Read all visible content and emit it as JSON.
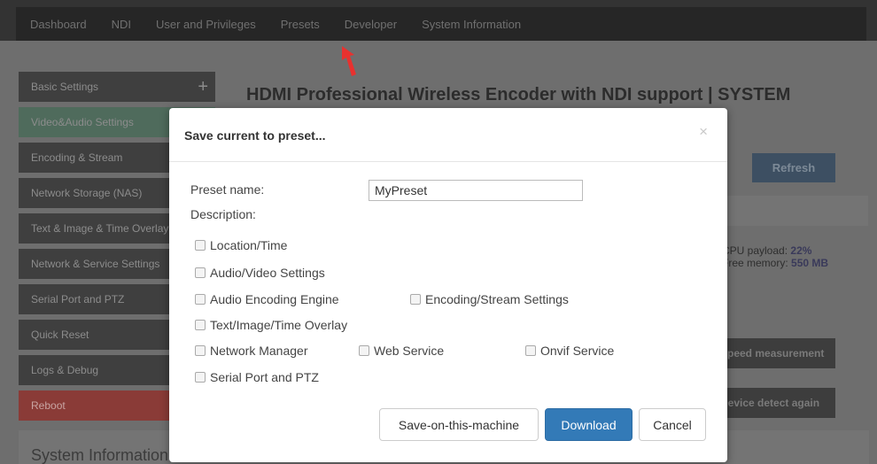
{
  "topnav": {
    "items": [
      "Dashboard",
      "NDI",
      "User and Privileges",
      "Presets",
      "Developer",
      "System Information"
    ]
  },
  "sidebar": {
    "items": [
      {
        "label": "Basic Settings",
        "expand": "+"
      },
      {
        "label": "Video&Audio Settings"
      },
      {
        "label": "Encoding & Stream"
      },
      {
        "label": "Network Storage (NAS)"
      },
      {
        "label": "Text & Image & Time Overlay"
      },
      {
        "label": "Network & Service Settings"
      },
      {
        "label": "Serial Port and PTZ"
      },
      {
        "label": "Quick Reset"
      },
      {
        "label": "Logs & Debug"
      },
      {
        "label": "Reboot"
      }
    ]
  },
  "main": {
    "title": "HDMI Professional Wireless Encoder with NDI support | SYSTEM",
    "refresh_label": "Refresh",
    "cpu_label": "CPU payload:",
    "cpu_value": "22%",
    "memory_label": "Free memory:",
    "memory_value": "550 MB",
    "measurement_label": "Speed measurement",
    "detect_label": "Device detect again",
    "footer_title": "System Information"
  },
  "modal": {
    "title": "Save current to preset...",
    "close_symbol": "×",
    "preset_name_label": "Preset name:",
    "preset_name_value": "MyPreset",
    "description_label": "Description:",
    "options": [
      {
        "label": "Location/Time",
        "checked": false
      },
      {
        "label": "Audio/Video Settings",
        "checked": false
      },
      {
        "label": "Audio Encoding Engine",
        "checked": false
      },
      {
        "label": "Encoding/Stream Settings",
        "checked": false
      },
      {
        "label": "Text/Image/Time Overlay",
        "checked": false
      },
      {
        "label": "Network Manager",
        "checked": false
      },
      {
        "label": "Web Service",
        "checked": false
      },
      {
        "label": "Onvif Service",
        "checked": false
      },
      {
        "label": "Serial Port and PTZ",
        "checked": false
      }
    ],
    "buttons": {
      "save_machine": "Save-on-this-machine",
      "download": "Download",
      "cancel": "Cancel"
    }
  },
  "colors": {
    "primary": "#337ab7",
    "annotation_arrow": "#e8312f"
  }
}
